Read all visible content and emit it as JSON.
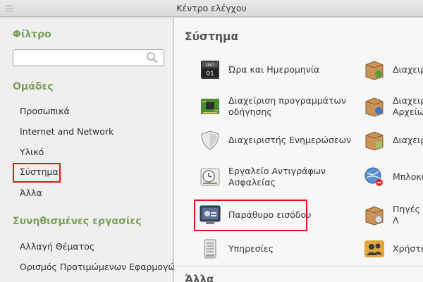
{
  "window": {
    "title": "Κέντρο ελέγχου"
  },
  "sidebar": {
    "filter_heading": "Φίλτρο",
    "search": {
      "value": "",
      "placeholder": ""
    },
    "groups_heading": "Ομάδες",
    "groups": [
      {
        "label": "Προσωπικά"
      },
      {
        "label": "Internet and Network"
      },
      {
        "label": "Υλικό"
      },
      {
        "label": "Σύστημα",
        "selected": true
      },
      {
        "label": "Άλλα"
      }
    ],
    "common_heading": "Συνηθισμένες εργασίες",
    "common": [
      {
        "label": "Αλλαγή Θέματος"
      },
      {
        "label": "Ορισμός Προτιμώμενων Εφαρμογών"
      }
    ]
  },
  "main": {
    "section_title": "Σύστημα",
    "next_section_title": "Άλλα",
    "items_left": [
      {
        "label": "Ώρα και Ημερομηνία",
        "icon": "calendar-clock-icon"
      },
      {
        "label": "Διαχείριση προγραμμάτων οδήγησης",
        "icon": "circuit-board-icon"
      },
      {
        "label": "Διαχειριστής Ενημερώσεων",
        "icon": "shield-icon"
      },
      {
        "label": "Εργαλείο Αντιγράφων Ασφαλείας",
        "icon": "backup-clock-icon"
      },
      {
        "label": "Παράθυρο εισόδου",
        "icon": "login-screen-icon",
        "highlighted": true
      },
      {
        "label": "Υπηρεσίες",
        "icon": "server-icon"
      }
    ],
    "items_right": [
      {
        "label": "Διαχειρ",
        "icon": "package-install-icon"
      },
      {
        "label": "Διαχειρ Αρχείων",
        "icon": "package-upload-icon"
      },
      {
        "label": "Διαχειρ",
        "icon": "package-check-icon"
      },
      {
        "label": "Μπλοκά",
        "icon": "network-block-icon"
      },
      {
        "label": "Πηγές Λ",
        "icon": "package-disc-icon"
      },
      {
        "label": "Χρήστες",
        "icon": "users-icon"
      }
    ]
  },
  "colors": {
    "accent_green": "#7aa05a",
    "highlight_red": "#e01515"
  }
}
